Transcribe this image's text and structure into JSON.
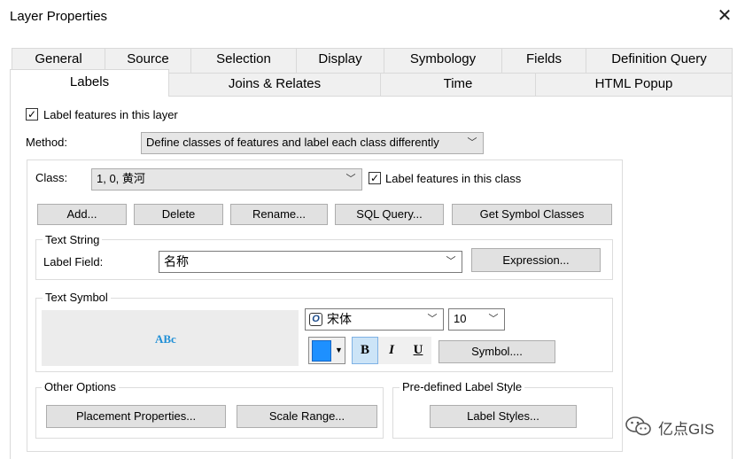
{
  "window": {
    "title": "Layer Properties",
    "close_glyph": "✕"
  },
  "tabs_row1": [
    "General",
    "Source",
    "Selection",
    "Display",
    "Symbology",
    "Fields",
    "Definition Query"
  ],
  "tabs_row2": [
    "Labels",
    "Joins & Relates",
    "Time",
    "HTML Popup"
  ],
  "active_tab": "Labels",
  "labels": {
    "label_features_layer": {
      "label": "Label features in this layer",
      "checked": true
    },
    "method_label": "Method:",
    "method_value": "Define classes of features and label each class differently",
    "class_label": "Class:",
    "class_value": "1, 0, 黄河",
    "label_features_class": {
      "label": "Label features in this class",
      "checked": true
    },
    "buttons": {
      "add": "Add...",
      "delete": "Delete",
      "rename": "Rename...",
      "sql_query": "SQL Query...",
      "get_symbol_classes": "Get Symbol Classes"
    },
    "text_string": {
      "legend": "Text String",
      "label_field_label": "Label Field:",
      "label_field_value": "名称",
      "expression_button": "Expression..."
    },
    "text_symbol": {
      "legend": "Text Symbol",
      "preview_text": "ABc",
      "preview_color": "#1f8fd6",
      "font_value": "宋体",
      "size_value": "10",
      "color_swatch": "#1e90ff",
      "bold": "B",
      "italic": "I",
      "underline": "U",
      "bold_active": true,
      "symbol_button": "Symbol...."
    },
    "other_options": {
      "legend": "Other Options",
      "placement_button": "Placement Properties...",
      "scale_button": "Scale Range..."
    },
    "predefined_style": {
      "legend": "Pre-defined Label Style",
      "label_styles_button": "Label Styles..."
    }
  },
  "watermark": {
    "text": "亿点GIS",
    "icon": "wechat-icon"
  }
}
